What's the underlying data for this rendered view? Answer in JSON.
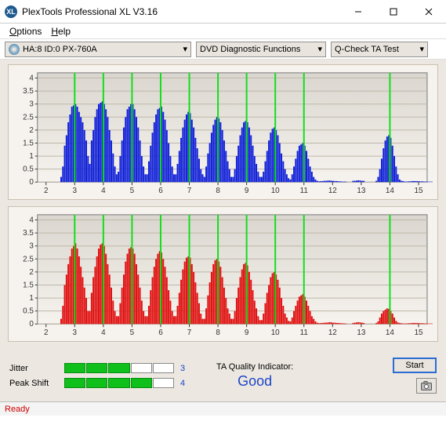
{
  "window": {
    "title": "PlexTools Professional XL V3.16",
    "icon_label": "XL"
  },
  "menu": {
    "options": "Options",
    "help": "Help"
  },
  "toolbar": {
    "drive_select": "HA:8 ID:0   PX-760A",
    "function_select": "DVD Diagnostic Functions",
    "test_select": "Q-Check TA Test"
  },
  "metrics": {
    "jitter_label": "Jitter",
    "jitter_value": "3",
    "jitter_filled": 3,
    "jitter_total": 5,
    "peak_label": "Peak Shift",
    "peak_value": "4",
    "peak_filled": 4,
    "peak_total": 5
  },
  "ta": {
    "label": "TA Quality Indicator:",
    "value": "Good"
  },
  "buttons": {
    "start": "Start"
  },
  "status": {
    "text": "Ready"
  },
  "chart_data": [
    {
      "type": "bar",
      "title": "",
      "xlabel": "",
      "ylabel": "",
      "color": "#1020d8",
      "xticks": [
        2,
        3,
        4,
        5,
        6,
        7,
        8,
        9,
        10,
        11,
        12,
        13,
        14,
        15
      ],
      "yticks": [
        0,
        0.5,
        1,
        1.5,
        2,
        2.5,
        3,
        3.5,
        4
      ],
      "xlim": [
        1.7,
        15.3
      ],
      "ylim": [
        0,
        4.2
      ],
      "green_lines": [
        3,
        4,
        5,
        6,
        7,
        8,
        9,
        10,
        11,
        14
      ],
      "segments": [
        [
          0.2,
          0.6,
          1.4,
          1.8,
          2.3,
          2.6,
          2.9,
          2.95,
          3.0,
          2.9,
          2.7,
          2.5,
          2.3,
          2.0,
          1.6,
          1.0
        ],
        [
          0.7,
          1.6,
          2.0,
          2.5,
          2.8,
          3.0,
          3.05,
          3.1,
          3.0,
          2.8,
          2.5,
          2.0,
          1.6,
          1.1,
          0.6,
          0.3
        ],
        [
          0.4,
          1.0,
          1.6,
          2.1,
          2.5,
          2.8,
          2.9,
          3.0,
          3.0,
          2.8,
          2.5,
          2.1,
          1.6,
          1.0,
          0.6,
          0.3
        ],
        [
          0.3,
          0.8,
          1.4,
          1.9,
          2.3,
          2.6,
          2.8,
          2.85,
          2.9,
          2.7,
          2.4,
          2.0,
          1.5,
          1.0,
          0.6,
          0.3
        ],
        [
          0.3,
          0.7,
          1.2,
          1.7,
          2.1,
          2.4,
          2.6,
          2.7,
          2.65,
          2.4,
          2.1,
          1.7,
          1.3,
          0.9,
          0.5,
          0.3
        ],
        [
          0.2,
          0.6,
          1.1,
          1.5,
          1.9,
          2.2,
          2.4,
          2.5,
          2.45,
          2.3,
          2.0,
          1.6,
          1.2,
          0.8,
          0.5,
          0.2
        ],
        [
          0.2,
          0.5,
          1.0,
          1.4,
          1.8,
          2.1,
          2.3,
          2.35,
          2.3,
          2.1,
          1.8,
          1.4,
          1.0,
          0.7,
          0.4,
          0.2
        ],
        [
          0.2,
          0.4,
          0.8,
          1.2,
          1.6,
          1.9,
          2.05,
          2.1,
          2.0,
          1.8,
          1.5,
          1.1,
          0.8,
          0.5,
          0.3,
          0.15
        ],
        [
          0.1,
          0.3,
          0.6,
          0.9,
          1.2,
          1.4,
          1.45,
          1.5,
          1.4,
          1.2,
          0.9,
          0.6,
          0.4,
          0.2,
          0.1,
          0.05
        ],
        [
          0.03,
          0.04,
          0.04,
          0.05,
          0.05,
          0.06,
          0.06,
          0.05,
          0.05,
          0.04,
          0.04,
          0.03,
          0.03,
          0.02,
          0.02,
          0.02
        ],
        [
          0.0,
          0.0,
          0.0,
          0.05,
          0.05,
          0.06,
          0.07,
          0.06,
          0.05,
          0.05,
          0.0,
          0.0,
          0.0,
          0.0,
          0.0,
          0.0
        ],
        [
          0.05,
          0.2,
          0.5,
          0.9,
          1.3,
          1.6,
          1.75,
          1.8,
          1.7,
          1.4,
          1.0,
          0.6,
          0.3,
          0.1,
          0.05,
          0.04
        ],
        [
          0.02,
          0.02,
          0.03,
          0.03,
          0.04,
          0.04,
          0.04,
          0.04,
          0.03,
          0.03,
          0.03,
          0.02,
          0.02,
          0.02,
          0.02,
          0.02
        ]
      ],
      "segment_centers": [
        3,
        4,
        5,
        6,
        7,
        8,
        9,
        10,
        11,
        12,
        13,
        14,
        15
      ]
    },
    {
      "type": "bar",
      "title": "",
      "xlabel": "",
      "ylabel": "",
      "color": "#e01010",
      "xticks": [
        2,
        3,
        4,
        5,
        6,
        7,
        8,
        9,
        10,
        11,
        12,
        13,
        14,
        15
      ],
      "yticks": [
        0,
        0.5,
        1,
        1.5,
        2,
        2.5,
        3,
        3.5,
        4
      ],
      "xlim": [
        1.7,
        15.3
      ],
      "ylim": [
        0,
        4.2
      ],
      "green_lines": [
        3,
        4,
        5,
        6,
        7,
        8,
        9,
        10,
        11,
        14
      ],
      "segments": [
        [
          0.2,
          0.7,
          1.5,
          1.9,
          2.3,
          2.6,
          2.9,
          3.0,
          3.1,
          2.9,
          2.6,
          2.2,
          1.8,
          1.4,
          1.0,
          0.5
        ],
        [
          0.5,
          1.2,
          1.8,
          2.2,
          2.6,
          2.9,
          3.05,
          3.1,
          3.0,
          2.7,
          2.3,
          1.9,
          1.4,
          0.9,
          0.5,
          0.3
        ],
        [
          0.3,
          0.8,
          1.4,
          1.9,
          2.4,
          2.7,
          2.9,
          2.95,
          2.9,
          2.7,
          2.3,
          1.9,
          1.4,
          0.9,
          0.5,
          0.3
        ],
        [
          0.3,
          0.7,
          1.3,
          1.8,
          2.2,
          2.5,
          2.7,
          2.8,
          2.75,
          2.5,
          2.2,
          1.8,
          1.3,
          0.9,
          0.5,
          0.3
        ],
        [
          0.3,
          0.7,
          1.2,
          1.7,
          2.1,
          2.4,
          2.55,
          2.6,
          2.55,
          2.3,
          2.0,
          1.6,
          1.2,
          0.8,
          0.4,
          0.2
        ],
        [
          0.2,
          0.6,
          1.1,
          1.6,
          2.0,
          2.3,
          2.45,
          2.5,
          2.4,
          2.2,
          1.8,
          1.4,
          1.0,
          0.6,
          0.4,
          0.2
        ],
        [
          0.2,
          0.5,
          1.0,
          1.4,
          1.8,
          2.1,
          2.3,
          2.35,
          2.25,
          2.0,
          1.7,
          1.3,
          0.9,
          0.6,
          0.3,
          0.15
        ],
        [
          0.15,
          0.4,
          0.8,
          1.2,
          1.5,
          1.8,
          1.95,
          2.0,
          1.9,
          1.7,
          1.4,
          1.0,
          0.7,
          0.4,
          0.25,
          0.12
        ],
        [
          0.1,
          0.25,
          0.5,
          0.7,
          0.9,
          1.05,
          1.1,
          1.15,
          1.05,
          0.9,
          0.7,
          0.5,
          0.3,
          0.2,
          0.1,
          0.05
        ],
        [
          0.03,
          0.04,
          0.04,
          0.05,
          0.05,
          0.06,
          0.07,
          0.06,
          0.05,
          0.05,
          0.04,
          0.04,
          0.03,
          0.03,
          0.02,
          0.02
        ],
        [
          0.0,
          0.0,
          0.0,
          0.04,
          0.05,
          0.06,
          0.07,
          0.06,
          0.05,
          0.04,
          0.0,
          0.0,
          0.0,
          0.0,
          0.0,
          0.0
        ],
        [
          0.04,
          0.1,
          0.25,
          0.4,
          0.5,
          0.55,
          0.6,
          0.58,
          0.5,
          0.4,
          0.25,
          0.12,
          0.06,
          0.04,
          0.03,
          0.02
        ],
        [
          0.02,
          0.02,
          0.03,
          0.03,
          0.04,
          0.04,
          0.04,
          0.04,
          0.03,
          0.03,
          0.03,
          0.02,
          0.02,
          0.02,
          0.02,
          0.02
        ]
      ],
      "segment_centers": [
        3,
        4,
        5,
        6,
        7,
        8,
        9,
        10,
        11,
        12,
        13,
        14,
        15
      ]
    }
  ]
}
